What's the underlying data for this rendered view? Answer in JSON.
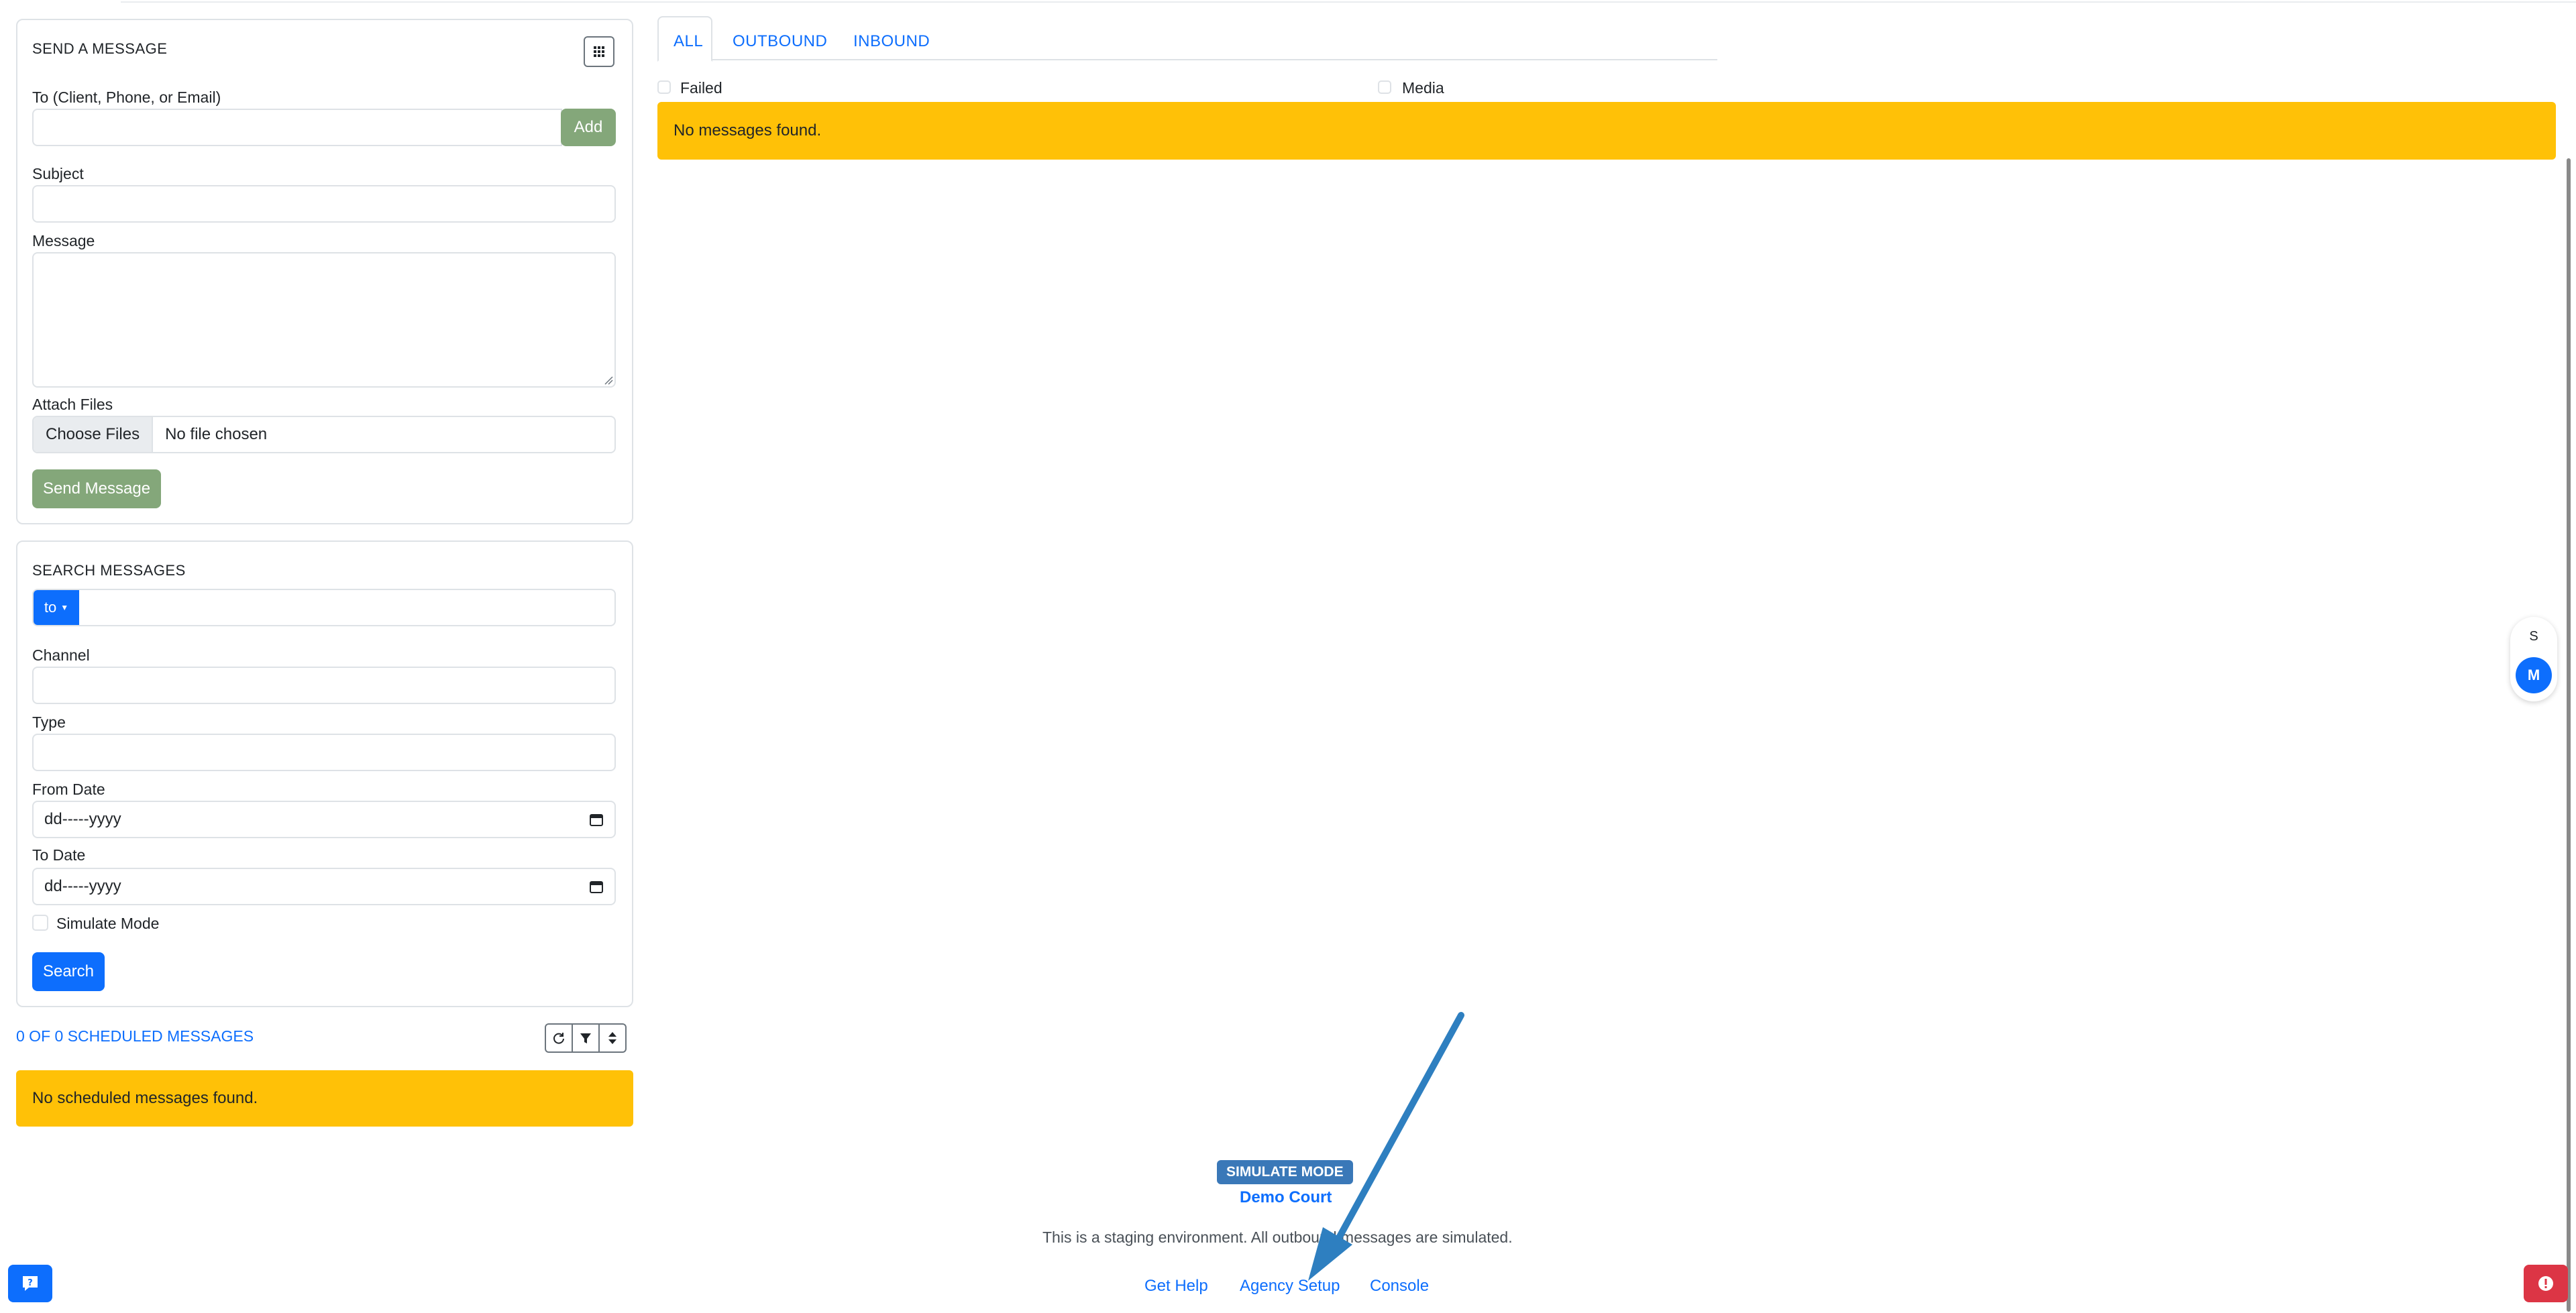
{
  "send_card": {
    "title": "SEND A MESSAGE",
    "to_label": "To (Client, Phone, or Email)",
    "add_button": "Add",
    "subject_label": "Subject",
    "message_label": "Message",
    "attach_label": "Attach Files",
    "choose_files_button": "Choose Files",
    "no_file_text": "No file chosen",
    "send_button": "Send Message"
  },
  "search_card": {
    "title": "SEARCH MESSAGES",
    "to_dropdown": "to",
    "channel_label": "Channel",
    "type_label": "Type",
    "from_date_label": "From Date",
    "from_date_value": "dd-----yyyy",
    "to_date_label": "To Date",
    "to_date_value": "dd-----yyyy",
    "simulate_label": "Simulate Mode",
    "search_button": "Search"
  },
  "scheduled": {
    "link_text": "0 OF 0 SCHEDULED MESSAGES",
    "empty_text": "No scheduled messages found."
  },
  "messages": {
    "tabs": [
      "ALL",
      "OUTBOUND",
      "INBOUND"
    ],
    "failed_label": "Failed",
    "media_label": "Media",
    "empty_text": "No messages found."
  },
  "side_pills": {
    "s_label": "S",
    "m_label": "M"
  },
  "footer": {
    "badge": "SIMULATE MODE",
    "org_name": "Demo Court",
    "notice": "This is a staging environment. All outbound messages are simulated.",
    "links": [
      "Get Help",
      "Agency Setup",
      "Console"
    ]
  },
  "colors": {
    "primary": "#0d6efd",
    "warning": "#ffc107",
    "success_muted": "#84a77a",
    "danger": "#dc3545",
    "annotation_arrow": "#2e7fc0"
  }
}
